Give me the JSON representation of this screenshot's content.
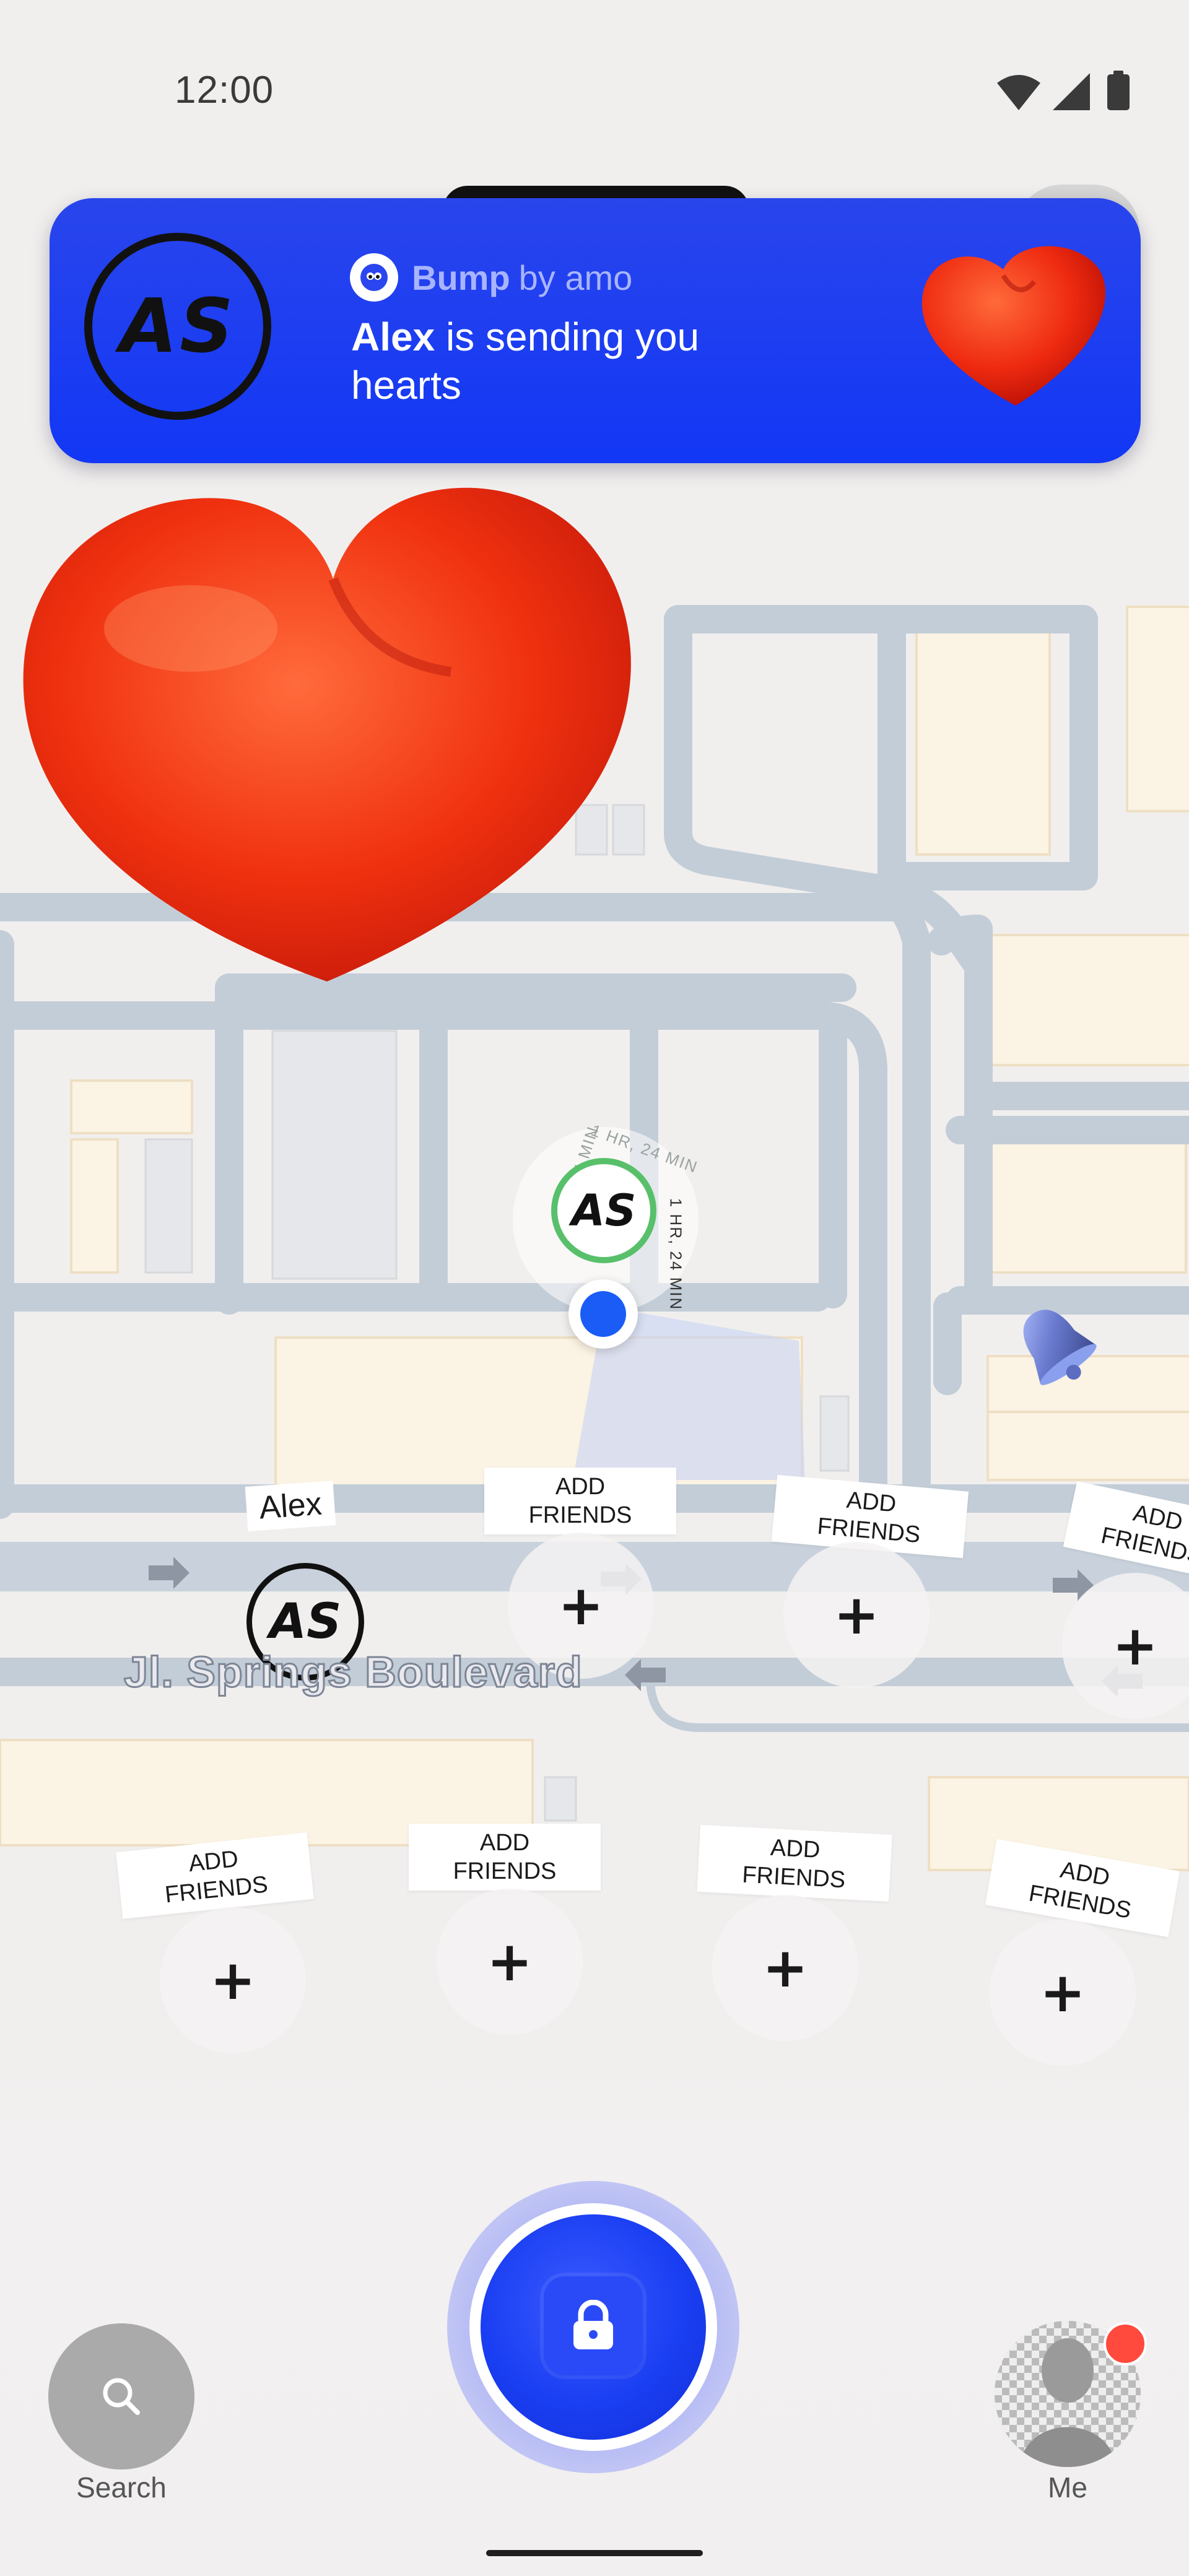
{
  "status_bar": {
    "time": "12:00"
  },
  "notification": {
    "avatar_initials": "AS",
    "app_name": "Bump",
    "app_by": "by amo",
    "sender": "Alex",
    "message": " is sending you hearts"
  },
  "map": {
    "street_name": "Jl. Springs Boulevard",
    "my_pin": {
      "initials": "AS",
      "ring_text": "1 HR, 24 MIN"
    },
    "friend": {
      "name": "Alex",
      "initials": "AS"
    },
    "add_friend_label_line1": "ADD",
    "add_friend_label_line2": "FRIENDS",
    "add_friend_plus": "+"
  },
  "bottom_nav": {
    "search_label": "Search",
    "me_label": "Me"
  },
  "colors": {
    "notification_bg": "#1f3ff2",
    "accent_blue": "#1a3ef2",
    "pin_green": "#58c06a",
    "badge_red": "#ff4a3d"
  }
}
